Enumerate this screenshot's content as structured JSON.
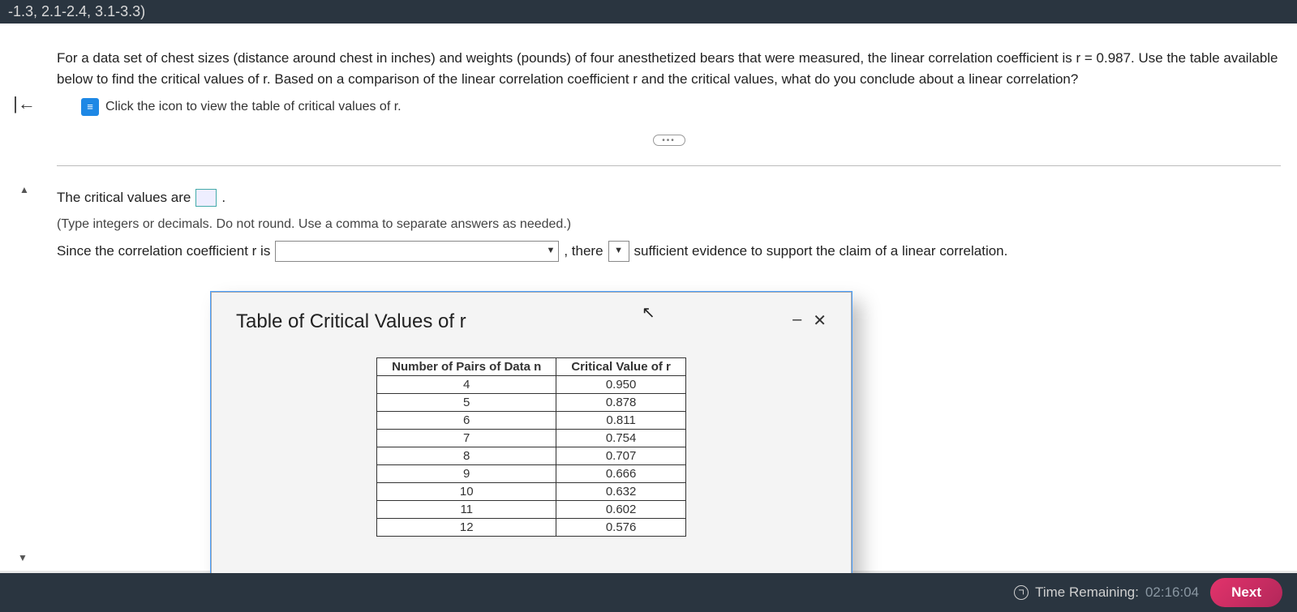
{
  "topbar": {
    "crumb": "-1.3, 2.1-2.4, 3.1-3.3)"
  },
  "question": {
    "text": "For a data set of chest sizes (distance around chest in inches) and weights (pounds) of four anesthetized bears that were measured, the linear correlation coefficient is r = 0.987. Use the table available below to find the critical values of r. Based on a comparison of the linear correlation coefficient r and the critical values, what do you conclude about a linear correlation?",
    "expand_link": "Click the icon to view the table of critical values of r."
  },
  "answers": {
    "row1_a": "The critical values are",
    "row1_c": ".",
    "hint": "(Type integers or decimals. Do not round. Use a comma to separate answers as needed.)",
    "row3_a": "Since the correlation coefficient r is",
    "row3_b": ", there",
    "row3_c": "sufficient evidence to support the claim of a linear correlation."
  },
  "dialog": {
    "title": "Table of Critical Values of r",
    "headers": {
      "col1": "Number of Pairs of Data n",
      "col2": "Critical Value of r"
    }
  },
  "chart_data": {
    "type": "table",
    "columns": [
      "Number of Pairs of Data n",
      "Critical Value of r"
    ],
    "rows": [
      {
        "n": 4,
        "cv": "0.950"
      },
      {
        "n": 5,
        "cv": "0.878"
      },
      {
        "n": 6,
        "cv": "0.811"
      },
      {
        "n": 7,
        "cv": "0.754"
      },
      {
        "n": 8,
        "cv": "0.707"
      },
      {
        "n": 9,
        "cv": "0.666"
      },
      {
        "n": 10,
        "cv": "0.632"
      },
      {
        "n": 11,
        "cv": "0.602"
      },
      {
        "n": 12,
        "cv": "0.576"
      }
    ]
  },
  "footer": {
    "time_label": "Time Remaining:",
    "time_value": "02:16:04",
    "next": "Next"
  },
  "glyphs": {
    "ellipsis": "•••",
    "chevron_down": "▼",
    "back": "|←",
    "up": "▲",
    "minimize": "–",
    "close": "✕"
  }
}
